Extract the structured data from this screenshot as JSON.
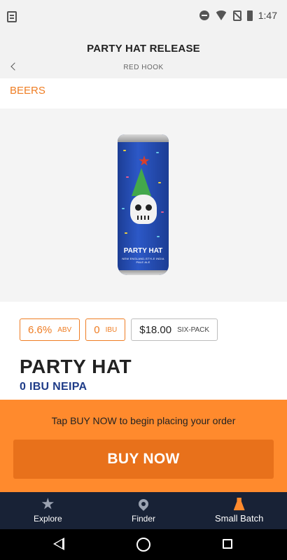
{
  "status_bar": {
    "time": "1:47"
  },
  "header": {
    "title": "PARTY HAT RELEASE",
    "subtitle": "RED HOOK"
  },
  "section_link": "BEERS",
  "can": {
    "brand_text": "PARTY HAT",
    "style_text": "NEW ENGLAND-STYLE INDIA PALE ALE"
  },
  "pills": {
    "abv_value": "6.6%",
    "abv_label": "ABV",
    "ibu_value": "0",
    "ibu_label": "IBU",
    "price_value": "$18.00",
    "price_label": "SIX-PACK"
  },
  "beer": {
    "name": "PARTY HAT",
    "style": "0 IBU NEIPA"
  },
  "cta": {
    "message": "Tap BUY NOW to begin placing your order",
    "button_label": "BUY NOW"
  },
  "tabs": [
    {
      "label": "Explore",
      "icon": "star-icon"
    },
    {
      "label": "Finder",
      "icon": "pin-icon"
    },
    {
      "label": "Small Batch",
      "icon": "flask-icon"
    }
  ],
  "colors": {
    "accent": "#ef7d23",
    "cta_bg": "#ff8a2d",
    "button": "#e8711b",
    "style_text": "#1f3c88",
    "tabbar": "#182236"
  }
}
